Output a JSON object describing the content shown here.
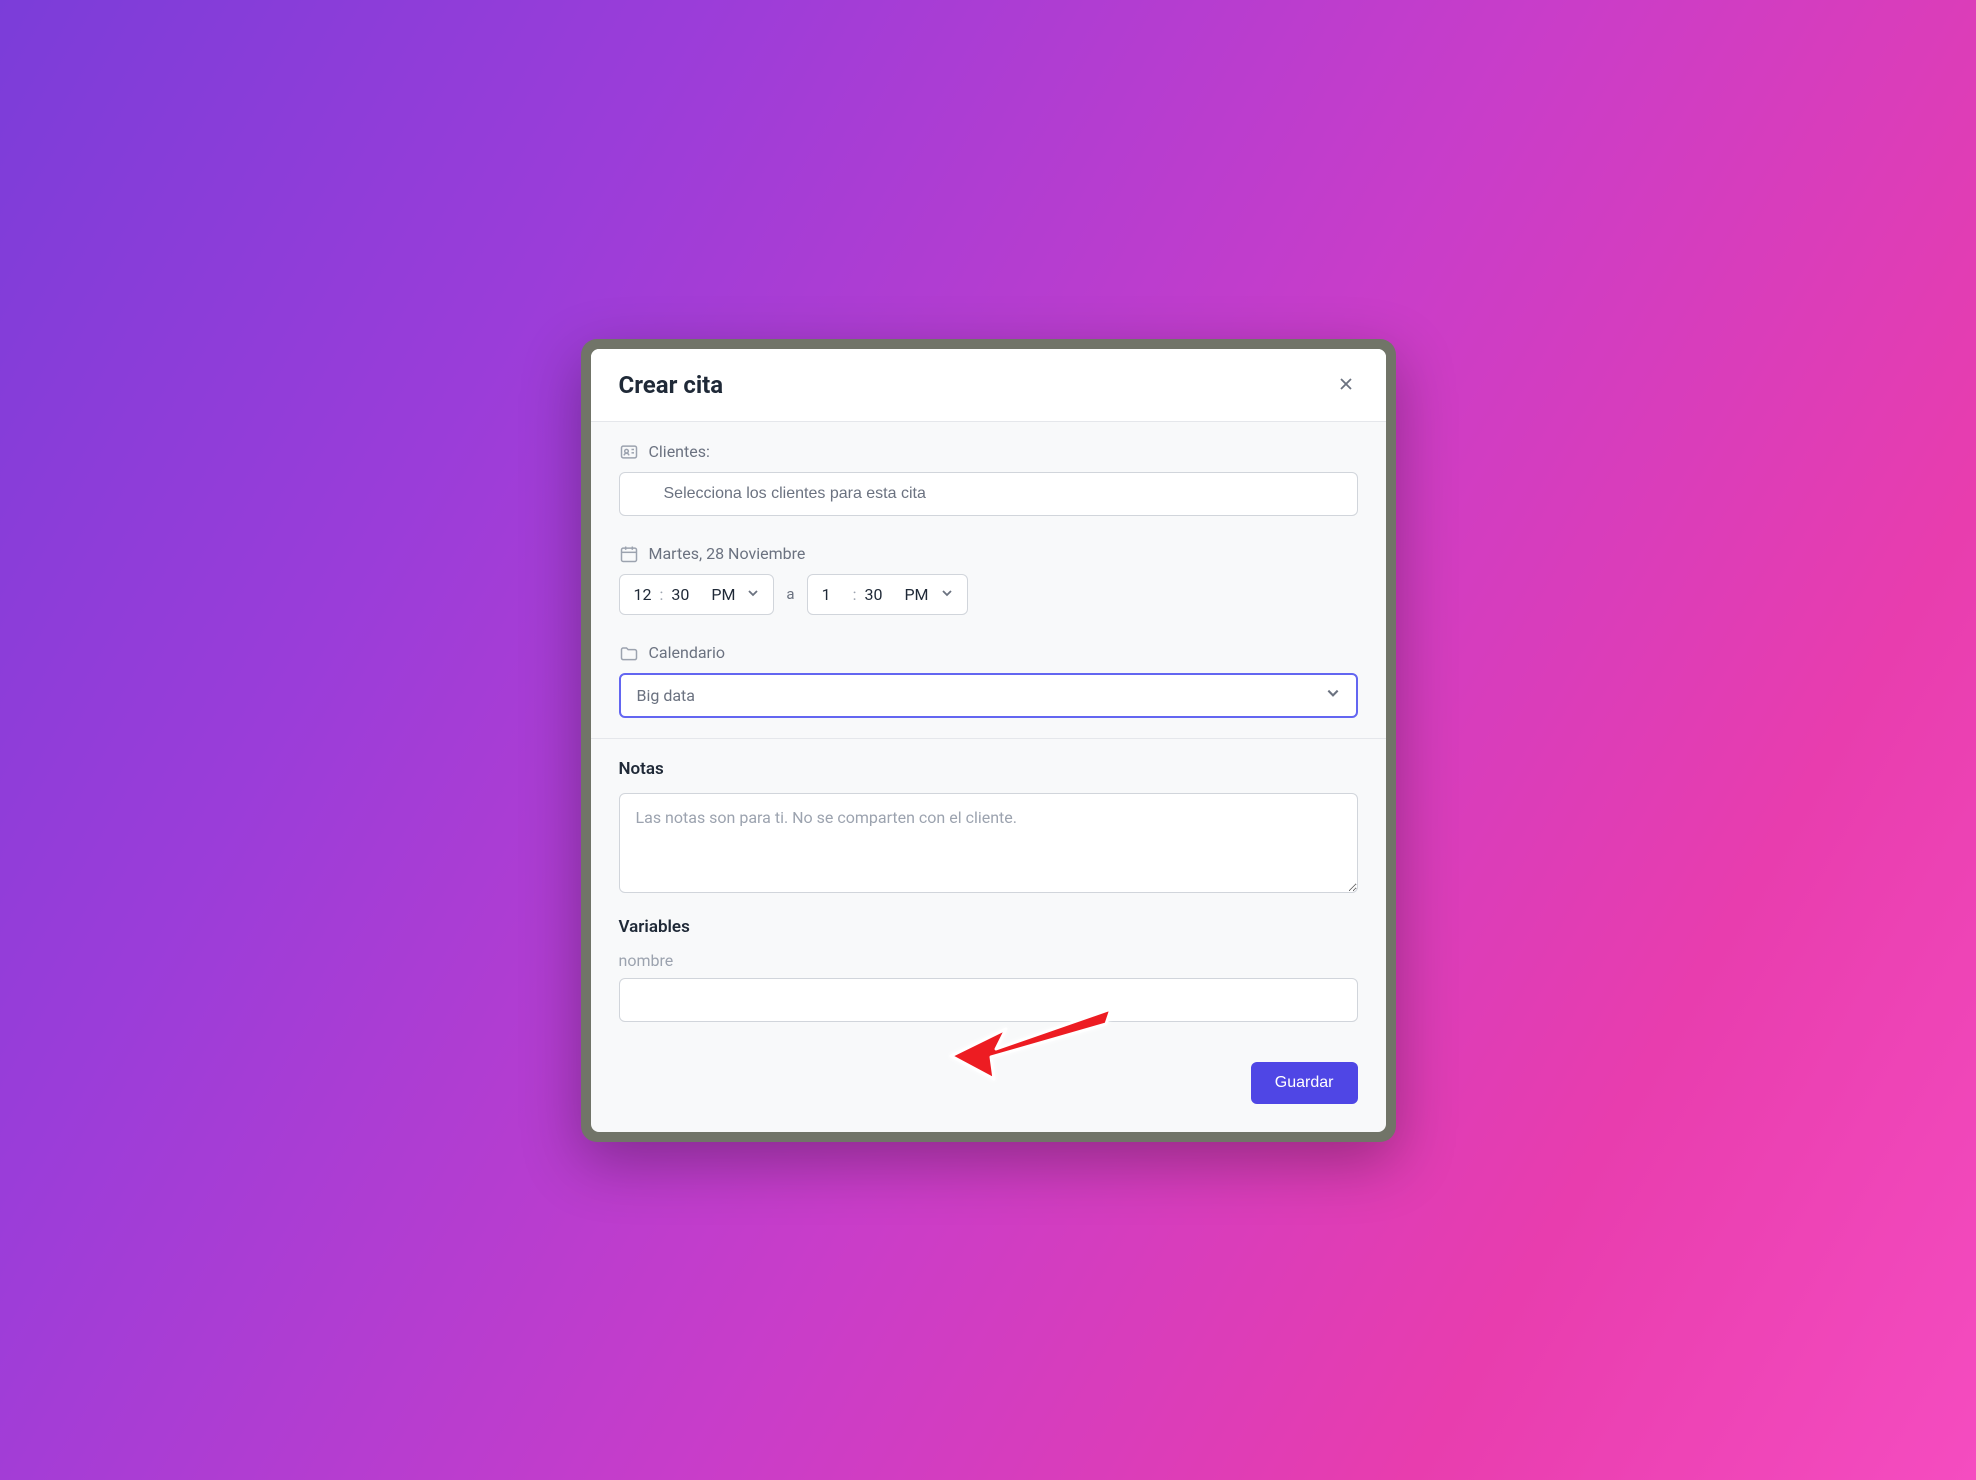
{
  "modal": {
    "title": "Crear cita"
  },
  "clients": {
    "label": "Clientes:",
    "placeholder": "Selecciona los clientes para esta cita"
  },
  "date": {
    "label": "Martes, 28 Noviembre"
  },
  "time": {
    "start": {
      "hour": "12",
      "minute": "30",
      "period": "PM"
    },
    "separator": "a",
    "end": {
      "hour": "1",
      "minute": "30",
      "period": "PM"
    }
  },
  "calendar": {
    "label": "Calendario",
    "selected": "Big data"
  },
  "notes": {
    "label": "Notas",
    "placeholder": "Las notas son para ti. No se comparten con el cliente."
  },
  "variables": {
    "label": "Variables",
    "field_name": "nombre"
  },
  "footer": {
    "save_label": "Guardar"
  }
}
